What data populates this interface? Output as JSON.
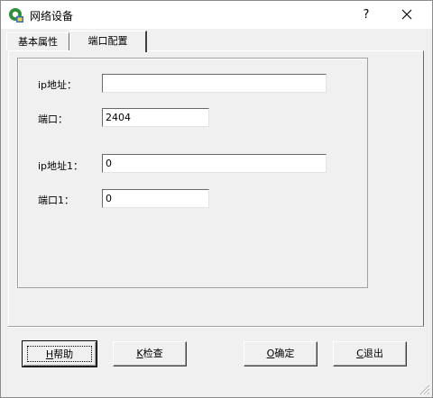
{
  "window": {
    "title": "网络设备",
    "help_label": "?"
  },
  "tabs": [
    {
      "label": "基本属性",
      "active": false
    },
    {
      "label": "端口配置",
      "active": true
    }
  ],
  "form": {
    "ip_label": "ip地址：",
    "ip_value": "",
    "port_label": "端口：",
    "port_value": "2404",
    "ip1_label": "ip地址1：",
    "ip1_value": "0",
    "port1_label": "端口1：",
    "port1_value": "0"
  },
  "buttons": {
    "help": {
      "mnemonic": "H",
      "label": "帮助"
    },
    "check": {
      "mnemonic": "K",
      "label": "检查"
    },
    "ok": {
      "mnemonic": "O",
      "label": "确定"
    },
    "exit": {
      "mnemonic": "C",
      "label": "退出"
    }
  },
  "colors": {
    "face": "#f0f0f0",
    "titlebar": "#ffffff",
    "field": "#ffffff"
  }
}
